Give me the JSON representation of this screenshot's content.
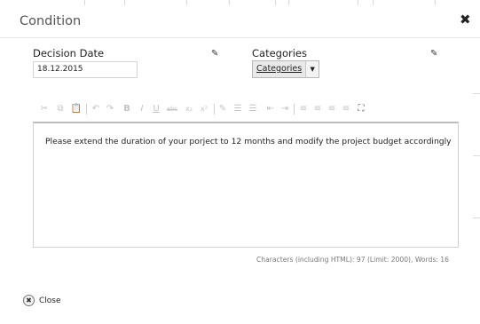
{
  "dialog": {
    "title": "Condition",
    "close_icon": "✖"
  },
  "fields": {
    "decision_date": {
      "label": "Decision Date",
      "value": "18.12.2015",
      "edit_icon": "✎"
    },
    "categories": {
      "label": "Categories",
      "dropdown_value": "Categories",
      "dropdown_arrow": "▼",
      "edit_icon": "✎"
    }
  },
  "toolbar": {
    "cut": "✂",
    "copy": "⧉",
    "paste": "📋",
    "undo": "↶",
    "redo": "↷",
    "bold": "B",
    "italic": "I",
    "underline": "U",
    "strike": "abc",
    "subscript": "x₂",
    "superscript": "x²",
    "remove_format": "✎",
    "numbered_list": "☰",
    "bullet_list": "☰",
    "outdent": "⇤",
    "indent": "⇥",
    "align_left": "≡",
    "align_center": "≡",
    "align_right": "≡",
    "justify": "≡",
    "maximize": "⛶"
  },
  "editor": {
    "content": "Please extend the duration of your porject to 12 months and modify the project budget accordingly"
  },
  "counter": "Characters (including HTML): 97 (Limit: 2000), Words: 16",
  "footer": {
    "close_label": "Close",
    "close_icon": "✖"
  }
}
